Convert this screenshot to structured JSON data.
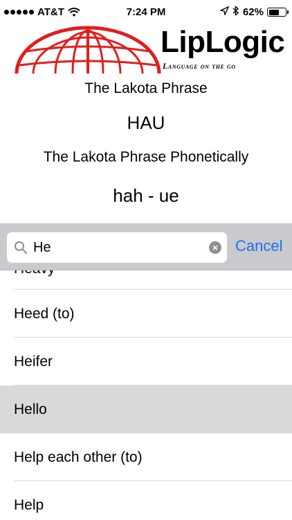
{
  "status_bar": {
    "carrier": "AT&T",
    "time": "7:24 PM",
    "battery_percent": "62%",
    "battery_level": 0.62
  },
  "logo": {
    "title": "LipLogic",
    "tagline": "Language on the go",
    "brand_color": "#e01e1e"
  },
  "phrase": {
    "label": "The Lakota Phrase",
    "value": "HAU",
    "phonetic_label": "The Lakota Phrase Phonetically",
    "phonetic_value": "hah - ue"
  },
  "search": {
    "value": "He",
    "cancel_label": "Cancel",
    "accent_color": "#1a73e8"
  },
  "results": {
    "partial_item": "Heavy",
    "items": [
      {
        "label": "Heed (to)",
        "selected": false
      },
      {
        "label": "Heifer",
        "selected": false
      },
      {
        "label": "Hello",
        "selected": true
      },
      {
        "label": "Help each other (to)",
        "selected": false
      },
      {
        "label": "Help",
        "selected": false
      }
    ]
  }
}
